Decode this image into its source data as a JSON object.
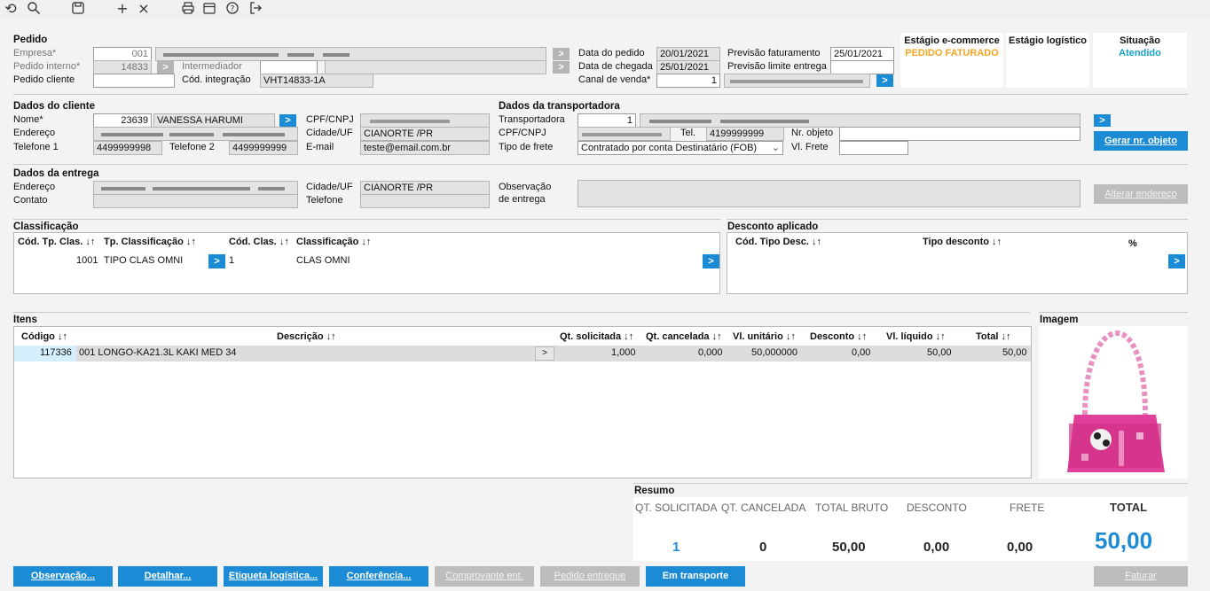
{
  "toolbar": {
    "icons": [
      "undo-icon",
      "search-icon",
      "save-icon",
      "add-icon",
      "close-icon",
      "print-icon",
      "calendar-icon",
      "help-icon",
      "exit-icon"
    ]
  },
  "pedido": {
    "title": "Pedido",
    "empresa_label": "Empresa*",
    "empresa_value": "001",
    "interno_label": "Pedido interno*",
    "interno_value": "14833",
    "intermediador_label": "Intermediador",
    "cliente_label": "Pedido cliente",
    "integracao_label": "Cód. integração",
    "integracao_value": "VHT14833-1A",
    "data_pedido_label": "Data do pedido",
    "data_pedido_value": "20/01/2021",
    "data_chegada_label": "Data de chegada",
    "data_chegada_value": "25/01/2021",
    "canal_label": "Canal de venda*",
    "canal_value": "1",
    "prev_fat_label": "Previsão faturamento",
    "prev_fat_value": "25/01/2021",
    "prev_lim_label": "Previsão limite entrega"
  },
  "status": {
    "ecommerce_title": "Estágio e-commerce",
    "ecommerce_value": "PEDIDO FATURADO",
    "logistico_title": "Estágio logístico",
    "situacao_title": "Situação",
    "situacao_value": "Atendido",
    "orange": "#f5a623",
    "teal": "#1aa0c8"
  },
  "cliente": {
    "title": "Dados do cliente",
    "nome_label": "Nome*",
    "codigo": "23639",
    "nome": "VANESSA HARUMI",
    "endereco_label": "Endereço",
    "tel1_label": "Telefone 1",
    "tel1": "4499999998",
    "tel2_label": "Telefone 2",
    "tel2": "4499999999",
    "cpf_label": "CPF/CNPJ",
    "cidade_label": "Cidade/UF",
    "cidade": "CIANORTE /PR",
    "email_label": "E-mail",
    "email": "teste@email.com.br"
  },
  "transp": {
    "title": "Dados da transportadora",
    "transp_label": "Transportadora",
    "transp_value": "1",
    "cpf_label": "CPF/CNPJ",
    "tel_label": "Tel.",
    "tel": "4199999999",
    "nr_label": "Nr. objeto",
    "frete_label": "Tipo de frete",
    "frete_value": "Contratado por conta Destinatário (FOB)",
    "vlfrete_label": "Vl. Frete",
    "gerar_btn": "Gerar nr. objeto"
  },
  "entrega": {
    "title": "Dados da entrega",
    "endereco_label": "Endereço",
    "contato_label": "Contato",
    "cidade_label": "Cidade/UF",
    "cidade": "CIANORTE /PR",
    "telefone_label": "Telefone",
    "obs_label1": "Observação",
    "obs_label2": "de entrega",
    "alterar_btn": "Alterar endereço"
  },
  "classificacao": {
    "title": "Classificação",
    "headers": [
      "Cód. Tp. Clas. ↓↑",
      "Tp. Classificação ↓↑",
      "Cód. Clas. ↓↑",
      "Classificação ↓↑"
    ],
    "row": [
      "1001",
      "TIPO CLAS OMNI",
      "1",
      "CLAS OMNI"
    ]
  },
  "desconto": {
    "title": "Desconto aplicado",
    "headers": [
      "Cód. Tipo Desc. ↓↑",
      "Tipo desconto ↓↑",
      "%"
    ]
  },
  "itens": {
    "title": "Itens",
    "headers": [
      "Código ↓↑",
      "Descrição ↓↑",
      "Qt. solicitada ↓↑",
      "Qt. cancelada ↓↑",
      "Vl. unitário ↓↑",
      "Desconto ↓↑",
      "Vl. líquido ↓↑",
      "Total ↓↑"
    ],
    "row": [
      "117336",
      "001 LONGO-KA21.3L KAKI MED 34",
      "1,000",
      "0,000",
      "50,000000",
      "0,00",
      "50,00",
      "50,00"
    ],
    "imagem_title": "Imagem"
  },
  "resumo": {
    "title": "Resumo",
    "labels": [
      "QT. SOLICITADA",
      "QT. CANCELADA",
      "TOTAL BRUTO",
      "DESCONTO",
      "FRETE",
      "TOTAL"
    ],
    "values": [
      "1",
      "0",
      "50,00",
      "0,00",
      "0,00",
      "50,00"
    ]
  },
  "buttons": {
    "observacao": "Observação...",
    "detalhar": "Detalhar...",
    "etiqueta": "Etiqueta logística...",
    "conferencia": "Conferência...",
    "comprovante": "Comprovante ent.",
    "entregue": "Pedido entregue",
    "transporte": "Em transporte",
    "faturar": "Faturar"
  },
  "go_arrow": ">"
}
